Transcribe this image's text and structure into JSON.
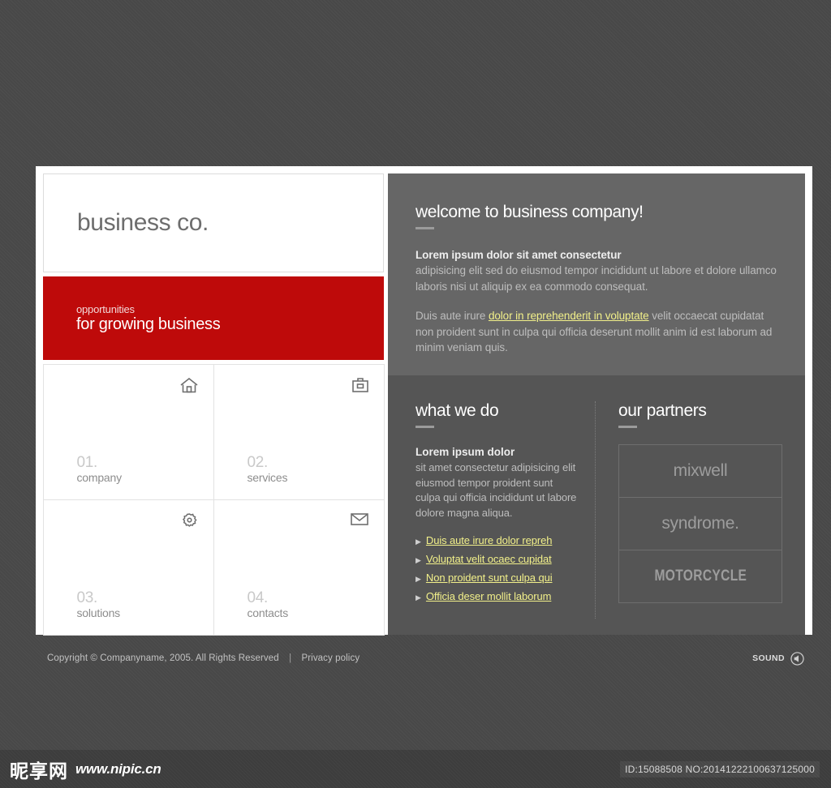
{
  "brand": {
    "logo": "business co."
  },
  "promo": {
    "line1": "opportunities",
    "line2": "for growing business"
  },
  "nav": {
    "items": [
      {
        "number": "01.",
        "label": "company",
        "icon": "home-icon",
        "active": true
      },
      {
        "number": "02.",
        "label": "services",
        "icon": "briefcase-icon",
        "active": false
      },
      {
        "number": "03.",
        "label": "solutions",
        "icon": "gear-icon",
        "active": false
      },
      {
        "number": "04.",
        "label": "contacts",
        "icon": "envelope-icon",
        "active": false
      }
    ]
  },
  "welcome": {
    "title": "welcome to business company!",
    "lead": "Lorem ipsum dolor sit amet consectetur",
    "body": "adipisicing elit sed do eiusmod tempor incididunt ut labore et dolore ullamco laboris nisi ut aliquip ex ea commodo consequat.",
    "para2_before": "Duis aute irure ",
    "para2_link": "dolor in reprehenderit in voluptate",
    "para2_after": " velit occaecat cupidatat non proident sunt in culpa qui officia deserunt mollit anim id est laborum ad minim veniam quis."
  },
  "what_we_do": {
    "title": "what we do",
    "lead": "Lorem ipsum dolor",
    "body": "sit amet consectetur adipisicing elit eiusmod tempor  proident sunt culpa qui officia incididunt ut labore dolore magna aliqua.",
    "links": [
      "Duis aute irure dolor repreh",
      "Voluptat velit ocaec cupidat",
      "Non proident sunt culpa qui",
      "Officia deser mollit laborum"
    ]
  },
  "partners": {
    "title": "our partners",
    "items": [
      {
        "name": "mixwell",
        "style": "normal"
      },
      {
        "name": "syndrome.",
        "style": "normal"
      },
      {
        "name": "MOTORCYCLE",
        "style": "condensed"
      }
    ]
  },
  "footer": {
    "copyright": "Copyright © Companyname, 2005. All Rights Reserved",
    "separator": "|",
    "privacy": "Privacy policy",
    "sound_label": "SOUND"
  },
  "watermark": {
    "cn_text": "昵享网",
    "url": "www.nipic.cn",
    "id_text": "ID:15088508 NO:20141222100637125000"
  },
  "colors": {
    "accent_red": "#be0a0a",
    "panel_light": "#666666",
    "panel_dark": "#555555",
    "link_yellow": "#f2f08a",
    "page_bg": "#4a4a4a"
  }
}
